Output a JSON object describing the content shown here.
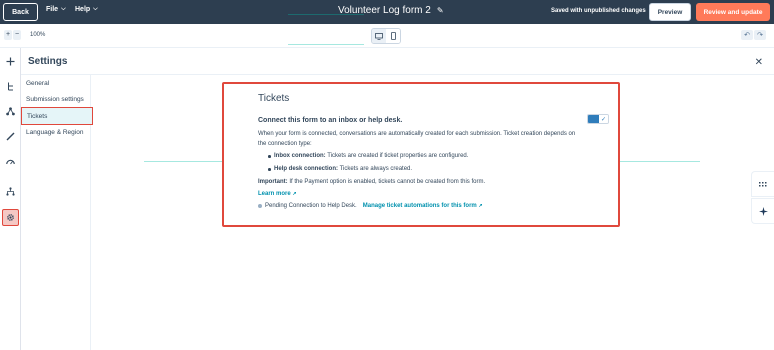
{
  "topbar": {
    "back_label": "Back",
    "file_label": "File",
    "help_label": "Help",
    "form_title": "Volunteer Log form 2",
    "saved_status": "Saved with unpublished changes",
    "preview_label": "Preview",
    "review_label": "Review and update"
  },
  "toolbar": {
    "zoom_out": "+",
    "zoom_in": "−",
    "zoom_level": "100%",
    "desktop_icon": "desktop-icon",
    "mobile_icon": "mobile-icon",
    "undo_icon": "undo-icon",
    "redo_icon": "redo-icon"
  },
  "rail": {
    "icons": [
      "add-icon",
      "tree-icon",
      "connect-icon",
      "brush-icon",
      "gauge-icon",
      "branch-icon",
      "gear-icon"
    ]
  },
  "settings": {
    "title": "Settings",
    "nav": [
      {
        "label": "General"
      },
      {
        "label": "Submission settings"
      },
      {
        "label": "Tickets"
      },
      {
        "label": "Language & Region"
      }
    ]
  },
  "tickets": {
    "title": "Tickets",
    "heading": "Connect this form to an inbox or help desk.",
    "description": "When your form is connected, conversations are automatically created for each submission. Ticket creation depends on the connection type:",
    "bullets": [
      {
        "label": "Inbox connection:",
        "text": " Tickets are created if ticket properties are configured."
      },
      {
        "label": "Help desk connection:",
        "text": " Tickets are always created."
      }
    ],
    "important_label": "Important:",
    "important_text": " If the Payment option is enabled, tickets cannot be created from this form.",
    "learn_more": "Learn more",
    "pending_text": "Pending Connection to Help Desk.",
    "manage_link": "Manage ticket automations for this form",
    "toggle_on": true
  },
  "colors": {
    "topbar_bg": "#2d3e50",
    "accent_orange": "#ff7a59",
    "highlight_red": "#e0483c",
    "link_teal": "#0091ae"
  }
}
